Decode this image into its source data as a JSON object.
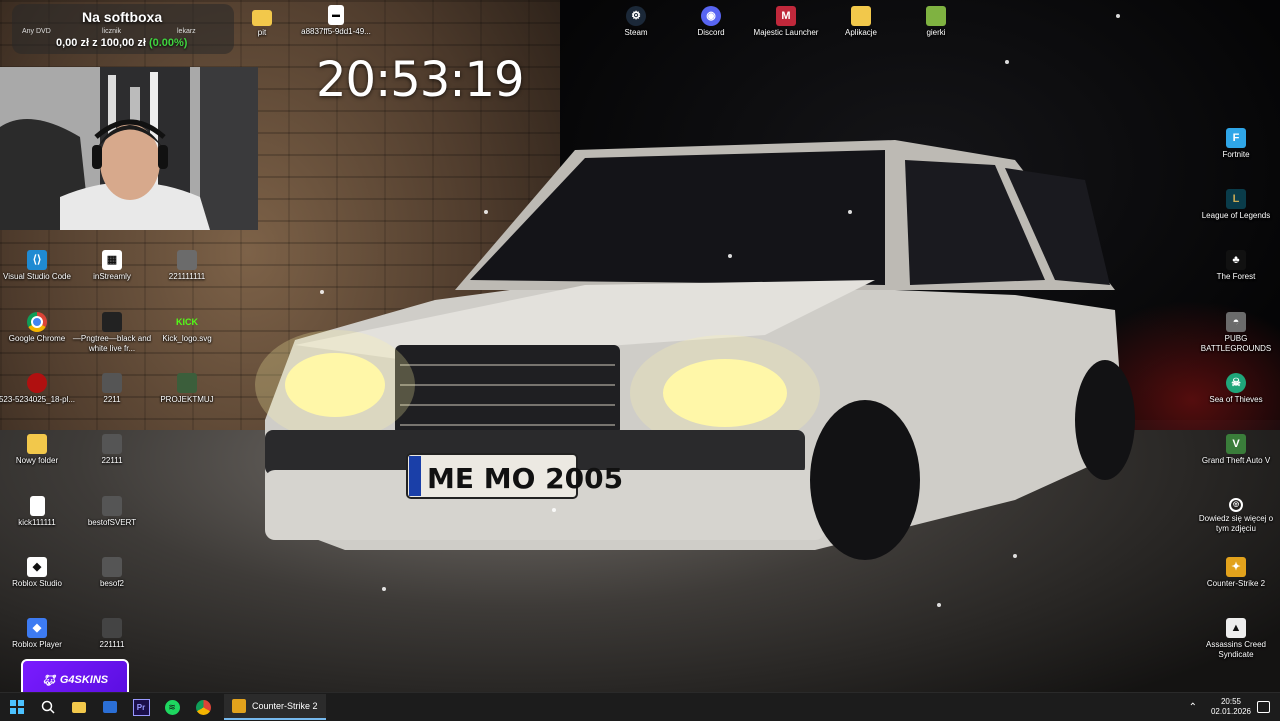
{
  "overlay": {
    "softbox_title": "Na softboxa",
    "amount_text": "0,00 zł z 100,00 zł",
    "percent_text": "(0.00%)",
    "left_label": "Any DVD",
    "mid_label": "licznik",
    "right_label": "lekarz"
  },
  "clock": {
    "time": "20:53:19"
  },
  "top_icons": [
    {
      "label": "pit",
      "icon": "folder-icon"
    },
    {
      "label": "a8837ff5-9dd1-49...",
      "icon": "file-icon"
    },
    {
      "label": "Steam",
      "icon": "steam-icon"
    },
    {
      "label": "Discord",
      "icon": "discord-icon"
    },
    {
      "label": "Majestic Launcher",
      "icon": "majestic-icon"
    },
    {
      "label": "Aplikacje",
      "icon": "folder-icon"
    },
    {
      "label": "gierki",
      "icon": "folder-icon"
    }
  ],
  "left_icons": [
    {
      "label": "Visual Studio Code",
      "icon": "vscode-icon"
    },
    {
      "label": "inStreamly",
      "icon": "instreamly-icon"
    },
    {
      "label": "221111111",
      "icon": "image-file-icon"
    },
    {
      "label": "Google Chrome",
      "icon": "chrome-icon"
    },
    {
      "label": "—Pngtree—black and white live fr...",
      "icon": "image-file-icon"
    },
    {
      "label": "Kick_logo.svg",
      "icon": "kick-icon"
    },
    {
      "label": "523-5234025_18-pl...",
      "icon": "image-file-icon"
    },
    {
      "label": "2211",
      "icon": "image-file-icon"
    },
    {
      "label": "PROJEKTMUJ",
      "icon": "image-file-icon"
    },
    {
      "label": "Nowy folder",
      "icon": "folder-icon"
    },
    {
      "label": "22111",
      "icon": "image-file-icon"
    },
    {
      "label": "kick111111",
      "icon": "text-file-icon"
    },
    {
      "label": "bestofSVERT",
      "icon": "image-file-icon"
    },
    {
      "label": "Roblox Studio",
      "icon": "roblox-studio-icon"
    },
    {
      "label": "besof2",
      "icon": "image-file-icon"
    },
    {
      "label": "Roblox Player",
      "icon": "roblox-player-icon"
    },
    {
      "label": "221111",
      "icon": "image-file-icon"
    }
  ],
  "right_icons": [
    {
      "label": "Fortnite",
      "icon": "fortnite-icon"
    },
    {
      "label": "League of Legends",
      "icon": "lol-icon"
    },
    {
      "label": "The Forest",
      "icon": "the-forest-icon"
    },
    {
      "label": "PUBG BATTLEGROUNDS",
      "icon": "pubg-icon"
    },
    {
      "label": "Sea of Thieves",
      "icon": "sea-of-thieves-icon"
    },
    {
      "label": "Grand Theft Auto V",
      "icon": "gta-icon"
    },
    {
      "label": "Dowiedz się więcej o tym zdjęciu",
      "icon": "info-icon"
    },
    {
      "label": "Counter-Strike 2",
      "icon": "cs2-icon"
    },
    {
      "label": "Assassins Creed Syndicate",
      "icon": "assassins-creed-icon"
    }
  ],
  "wallpaper": {
    "plate": "ME MO 2005"
  },
  "badge": {
    "label": "G4SKINS"
  },
  "taskbar": {
    "active_app": "Counter-Strike 2",
    "time": "20:55",
    "date": "02.01.2026"
  },
  "colors": {
    "accent": "#76b9ed",
    "badge": "#6a14f0",
    "kick": "#53fc18",
    "percent": "#3fd43f"
  }
}
